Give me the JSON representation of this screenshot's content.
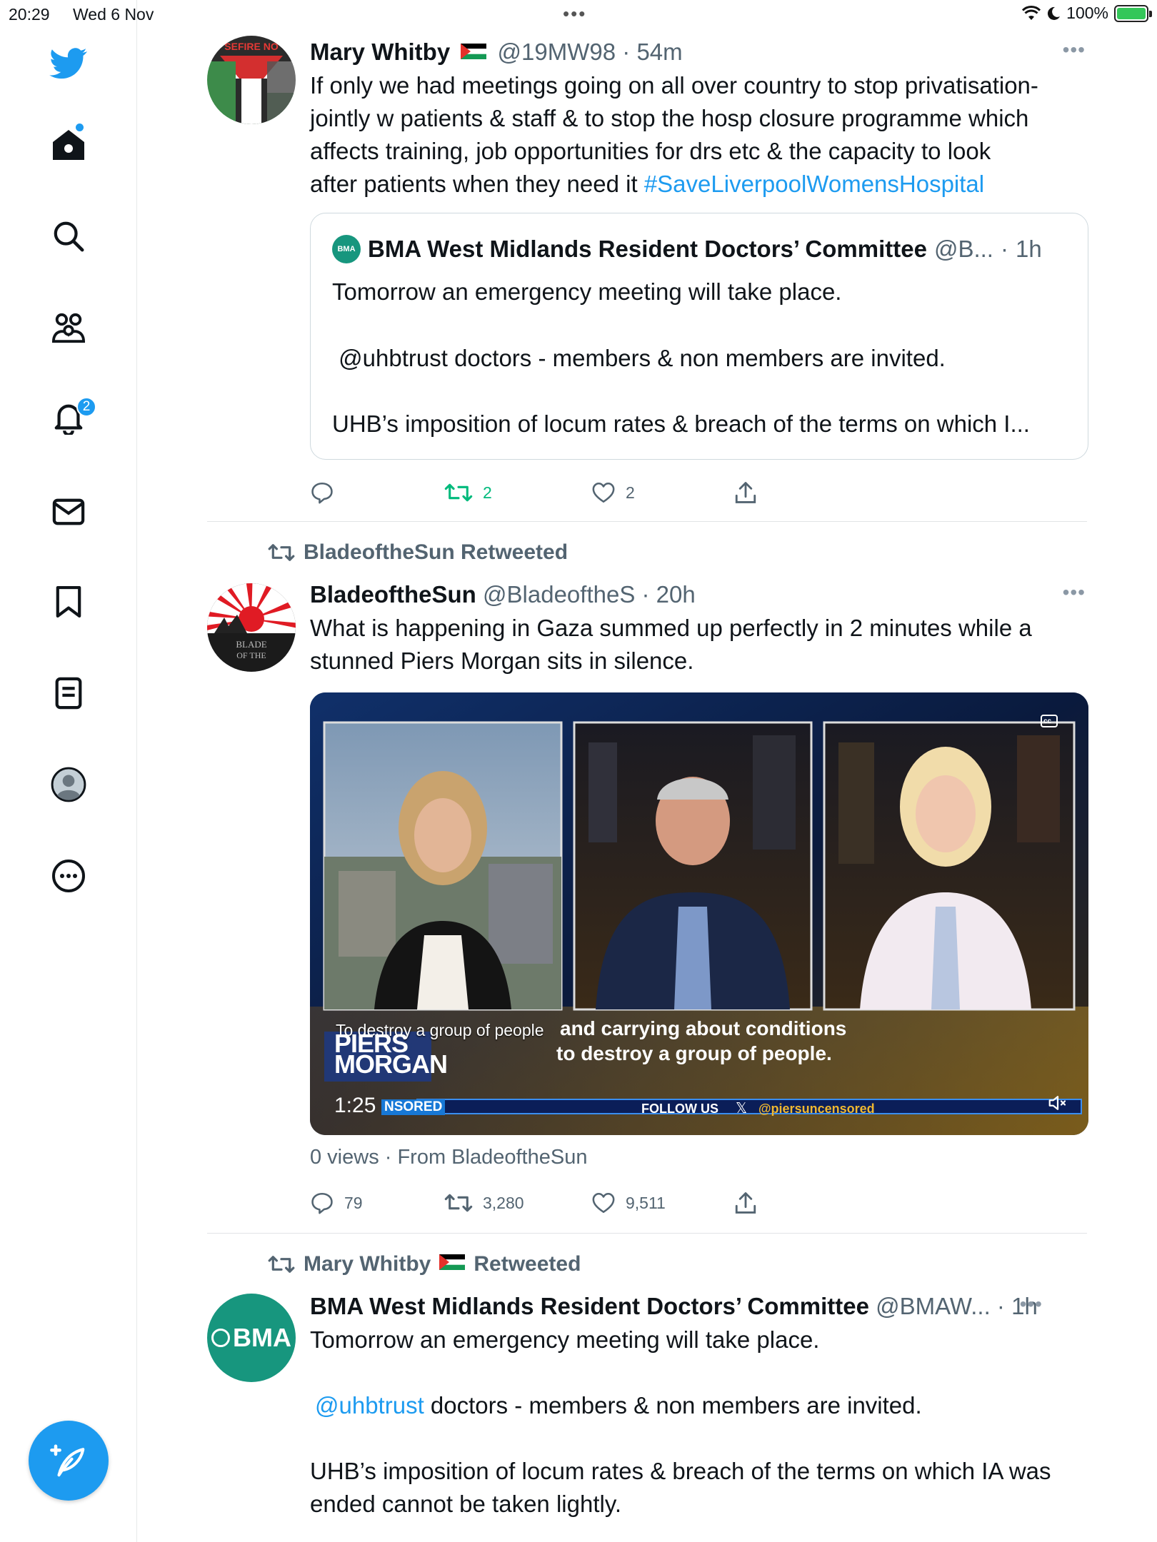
{
  "status_bar": {
    "time": "20:29",
    "date": "Wed 6 Nov",
    "battery": "100%"
  },
  "sidebar": {
    "items": [
      {
        "name": "twitter-logo"
      },
      {
        "name": "home"
      },
      {
        "name": "search"
      },
      {
        "name": "communities"
      },
      {
        "name": "notifications"
      },
      {
        "name": "messages"
      },
      {
        "name": "bookmarks"
      },
      {
        "name": "lists"
      },
      {
        "name": "profile"
      },
      {
        "name": "more"
      }
    ],
    "notifications_badge": "2"
  },
  "tweets": [
    {
      "author": "Mary Whitby",
      "handle": "@19MW98",
      "sep": "·",
      "time": "54m",
      "text_lines": [
        "If only we had meetings going on all over country to stop privatisation-",
        "jointly w patients & staff & to stop the hosp closure programme which",
        "affects training, job opportunities for drs etc & the capacity to look",
        "after patients when they need it "
      ],
      "hashtag": "#SaveLiverpoolWomensHospital",
      "quote": {
        "author": "BMA West Midlands Resident Doctors’ Committee",
        "handle": "@B...",
        "sep": "·",
        "time": "1h",
        "line1": "Tomorrow an emergency meeting will take place.",
        "line2": " @uhbtrust doctors - members & non members are invited.",
        "line3": "UHB’s imposition of locum rates & breach of the terms on which I..."
      },
      "replies": "",
      "retweets": "2",
      "likes": "2"
    },
    {
      "retweeted_by": "BladeoftheSun Retweeted",
      "author": "BladeoftheSun",
      "handle": "@BladeoftheS",
      "sep": "·",
      "time": "20h",
      "text_lines": [
        "What is happening in Gaza summed up perfectly in 2 minutes while a",
        "stunned Piers Morgan sits in silence."
      ],
      "video": {
        "caption_small": "To destroy a group of people",
        "caption_line1": "and carrying about conditions",
        "caption_line2": "to destroy a group of people.",
        "show_name_1": "PIERS",
        "show_name_2": "MORGAN",
        "show_tag": "NSORED",
        "duration": "1:25",
        "follow": "FOLLOW US",
        "handle": "@piersuncensored",
        "cc": "cc"
      },
      "views": "0 views · From BladeoftheSun",
      "replies": "79",
      "retweets": "3,280",
      "likes": "9,511"
    },
    {
      "retweeted_by_name": "Mary Whitby",
      "retweeted_by_suffix": "Retweeted",
      "author": "BMA West Midlands Resident Doctors’ Committee",
      "handle": "@BMAW...",
      "sep": "·",
      "time": "1h",
      "avatar_text": "BMA",
      "line1": "Tomorrow an emergency meeting will take place.",
      "mention": "@uhbtrust",
      "line2_rest": " doctors - members & non members are invited.",
      "line3": "UHB’s imposition of locum rates & breach of the terms on which IA was",
      "line4": "ended cannot be taken lightly."
    }
  ],
  "colors": {
    "accent": "#1d9bf0",
    "retweet_active": "#00ba7c",
    "muted": "#536471"
  }
}
